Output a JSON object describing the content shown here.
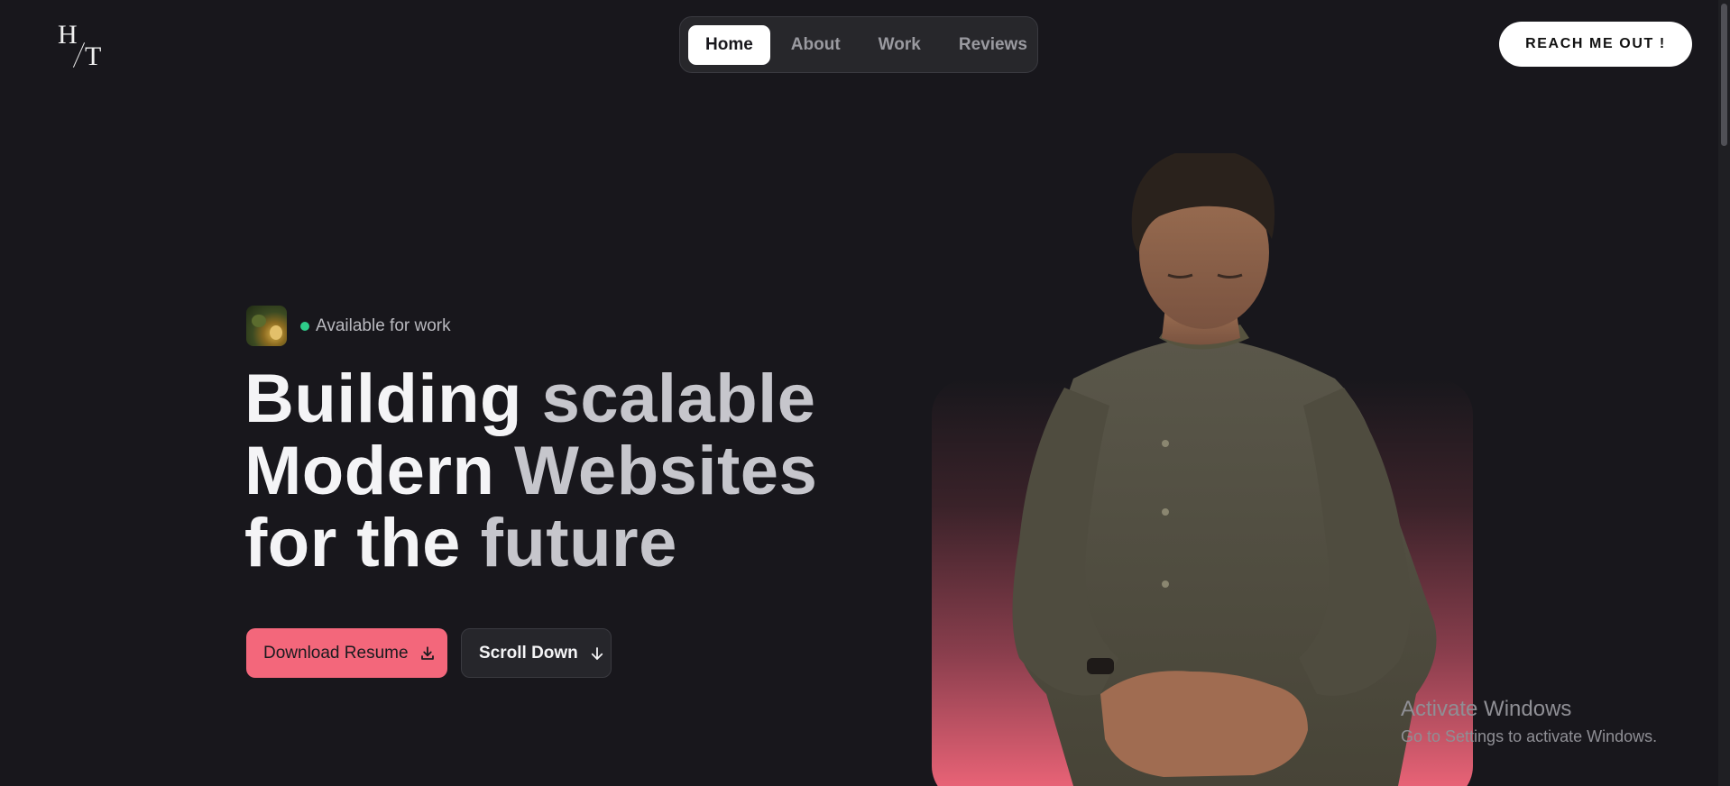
{
  "logo": {
    "left": "H",
    "right": "T"
  },
  "nav": {
    "items": [
      {
        "label": "Home",
        "active": true
      },
      {
        "label": "About",
        "active": false
      },
      {
        "label": "Work",
        "active": false
      },
      {
        "label": "Reviews",
        "active": false
      }
    ]
  },
  "cta": {
    "label": "REACH ME OUT !"
  },
  "hero": {
    "availability": "Available for work",
    "headline": {
      "line1_a": "Building",
      "line1_b": "scalable",
      "line2_a": "Modern",
      "line2_b": "Websites",
      "line3_a": "for the",
      "line3_b": "future"
    },
    "buttons": {
      "resume": "Download Resume",
      "scroll": "Scroll Down"
    }
  },
  "watermark": {
    "title": "Activate Windows",
    "subtitle": "Go to Settings to activate Windows."
  },
  "colors": {
    "background": "#18171c",
    "accent": "#f3677b",
    "status_dot": "#2ecc8a"
  },
  "icons": [
    "download-icon",
    "arrow-down-icon",
    "status-dot-icon"
  ]
}
